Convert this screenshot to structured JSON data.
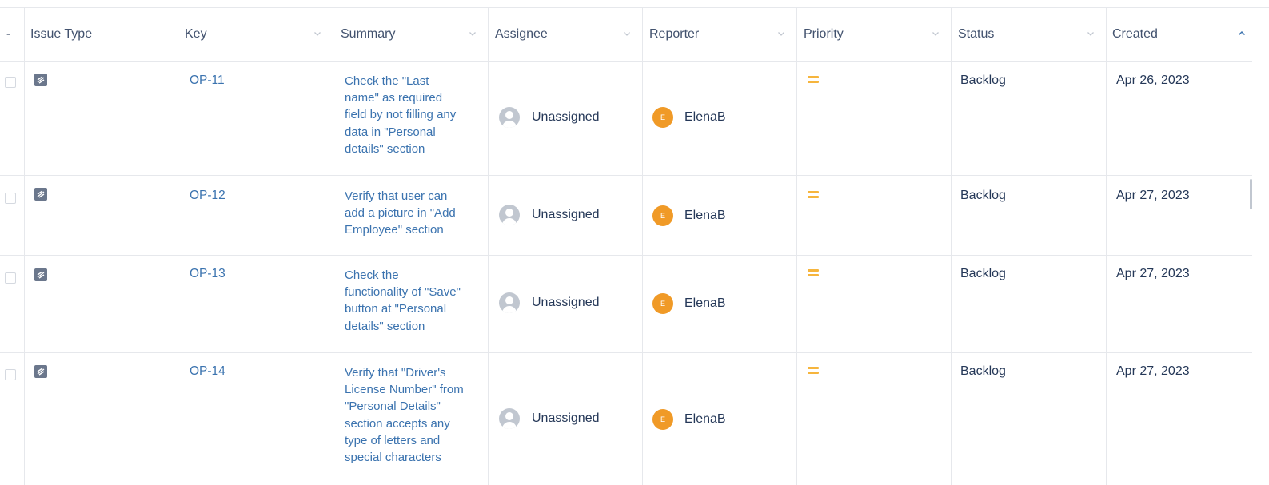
{
  "header": {
    "select_all": "-",
    "columns": [
      {
        "label": "Issue Type"
      },
      {
        "label": "Key"
      },
      {
        "label": "Summary"
      },
      {
        "label": "Assignee"
      },
      {
        "label": "Reporter"
      },
      {
        "label": "Priority"
      },
      {
        "label": "Status"
      },
      {
        "label": "Created"
      }
    ],
    "sorted_column": "Created",
    "sort_direction": "ascending"
  },
  "icons": {
    "issue_type": "test-case-icon",
    "priority": "priority-medium-icon",
    "assignee_avatar": "default-user-avatar",
    "reporter_avatar_letter": "E"
  },
  "colors": {
    "link": "#3b73af",
    "priority_medium": "#f6b53d",
    "reporter_avatar": "#f09a27",
    "header_text": "#42526e"
  },
  "rows": [
    {
      "key": "OP-11",
      "summary_lines": [
        "Check the \"Last",
        "name\" as required",
        "field by not filling any",
        "data in \"Personal",
        "details\" section"
      ],
      "assignee": "Unassigned",
      "reporter": "ElenaB",
      "priority": "Medium",
      "status": "Backlog",
      "created": "Apr 26, 2023"
    },
    {
      "key": "OP-12",
      "summary_lines": [
        "Verify that user can",
        "add a picture in \"Add",
        "Employee\" section"
      ],
      "assignee": "Unassigned",
      "reporter": "ElenaB",
      "priority": "Medium",
      "status": "Backlog",
      "created": "Apr 27, 2023"
    },
    {
      "key": "OP-13",
      "summary_lines": [
        "Check the",
        "functionality of \"Save\"",
        "button at \"Personal",
        "details\" section"
      ],
      "assignee": "Unassigned",
      "reporter": "ElenaB",
      "priority": "Medium",
      "status": "Backlog",
      "created": "Apr 27, 2023"
    },
    {
      "key": "OP-14",
      "summary_lines": [
        "Verify that \"Driver's",
        "License Number\" from",
        "\"Personal Details\"",
        "section accepts any",
        "type of letters and",
        "special characters"
      ],
      "assignee": "Unassigned",
      "reporter": "ElenaB",
      "priority": "Medium",
      "status": "Backlog",
      "created": "Apr 27, 2023"
    }
  ]
}
